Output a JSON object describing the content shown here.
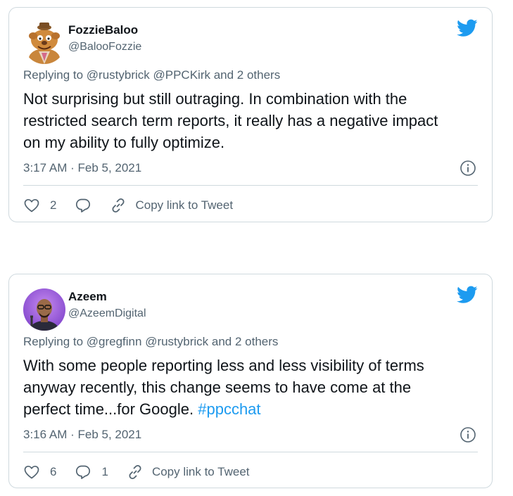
{
  "tweets": [
    {
      "name": "FozzieBaloo",
      "handle": "@BalooFozzie",
      "reply_to": "Replying to @rustybrick @PPCKirk and 2 others",
      "body_lines": [
        "Not surprising but still outraging. In combination with the",
        "restricted search term reports, it really has a negative impact",
        "on my ability to fully optimize."
      ],
      "timestamp": "3:17 AM · Feb 5, 2021",
      "likes": "2",
      "replies": "",
      "copy_link": "Copy link to Tweet"
    },
    {
      "name": "Azeem",
      "handle": "@AzeemDigital",
      "reply_to": "Replying to @gregfinn @rustybrick and 2 others",
      "body_lines": [
        "With some people reporting less and less visibility of terms",
        "anyway recently, this change seems to have come at the",
        "perfect time...for Google. "
      ],
      "hashtag": "#ppcchat",
      "timestamp": "3:16 AM · Feb 5, 2021",
      "likes": "6",
      "replies": "1",
      "copy_link": "Copy link to Tweet"
    }
  ],
  "colors": {
    "twitter_blue": "#1d9bf0",
    "secondary_text": "#536471",
    "border": "#cfd9de"
  },
  "icons": [
    "twitter-bird-icon",
    "info-icon",
    "heart-icon",
    "reply-icon",
    "link-icon"
  ]
}
